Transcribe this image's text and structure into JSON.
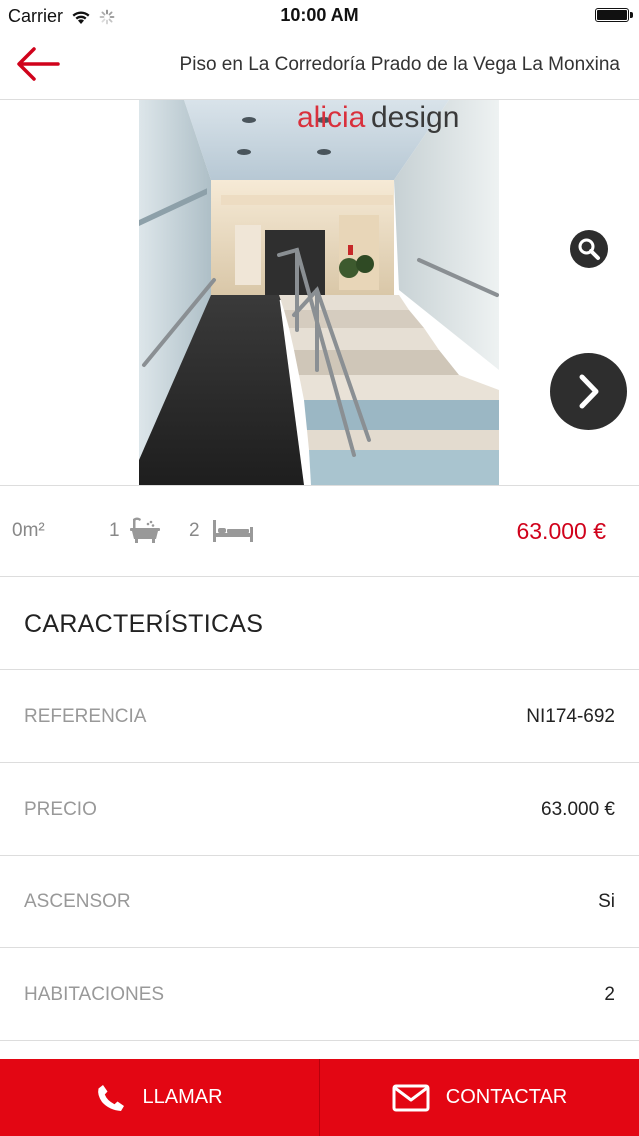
{
  "status_bar": {
    "carrier": "Carrier",
    "time": "10:00 AM"
  },
  "nav": {
    "title": "Piso en La Corredoría Prado de la Vega La Monxina"
  },
  "gallery": {
    "watermark_part1": "alicia",
    "watermark_part2": "design"
  },
  "summary": {
    "area": "0m²",
    "bathrooms": "1",
    "bedrooms": "2",
    "price": "63.000 €"
  },
  "features": {
    "title": "CARACTERÍSTICAS",
    "rows": [
      {
        "label": "REFERENCIA",
        "value": "NI174-692"
      },
      {
        "label": "PRECIO",
        "value": "63.000 €"
      },
      {
        "label": "ASCENSOR",
        "value": "Si"
      },
      {
        "label": "HABITACIONES",
        "value": "2"
      }
    ]
  },
  "actions": {
    "call_label": "LLAMAR",
    "contact_label": "CONTACTAR"
  },
  "colors": {
    "accent": "#e30613",
    "price": "#d0021b"
  }
}
